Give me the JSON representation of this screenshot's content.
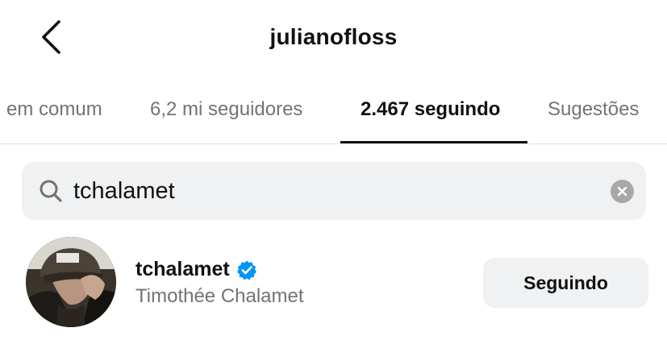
{
  "header": {
    "title": "julianofloss",
    "back_icon": "chevron-left-icon"
  },
  "tabs": [
    {
      "label": "em comum",
      "active": false
    },
    {
      "label": "6,2 mi seguidores",
      "active": false
    },
    {
      "label": "2.467 seguindo",
      "active": true
    },
    {
      "label": "Sugestões",
      "active": false
    }
  ],
  "search": {
    "value": "tchalamet",
    "icon": "search-icon",
    "clear_icon": "clear-icon"
  },
  "results": [
    {
      "username": "tchalamet",
      "verified": true,
      "full_name": "Timothée Chalamet",
      "button_label": "Seguindo"
    }
  ],
  "colors": {
    "verified_badge": "#0095f6",
    "secondary_text": "#737373",
    "pill_background": "#eff1f3"
  }
}
